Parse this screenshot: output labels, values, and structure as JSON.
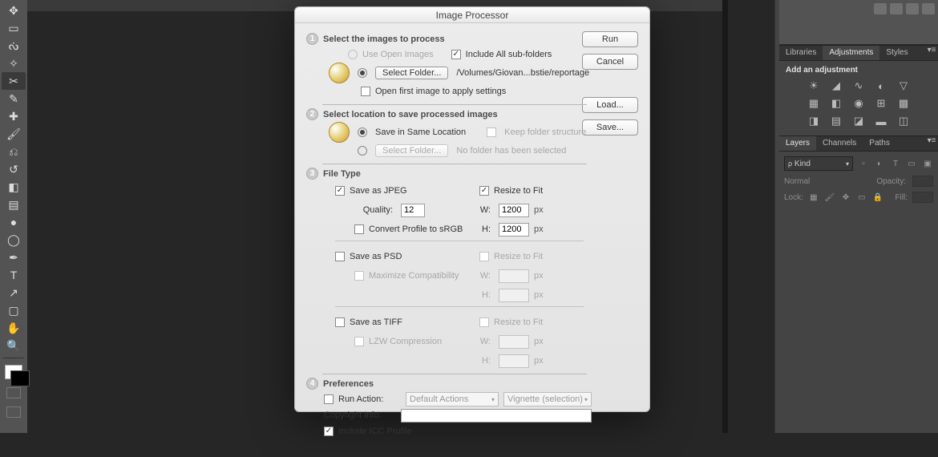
{
  "dialog": {
    "title": "Image Processor",
    "buttons": {
      "run": "Run",
      "cancel": "Cancel",
      "load": "Load...",
      "save": "Save..."
    },
    "s1": {
      "title": "Select the images to process",
      "use_open_images": "Use Open Images",
      "include_sub": "Include All sub-folders",
      "select_folder_btn": "Select Folder...",
      "folder_path": "/Volumes/Giovan...bstie/reportage",
      "open_first": "Open first image to apply settings"
    },
    "s2": {
      "title": "Select location to save processed images",
      "same_loc": "Save in Same Location",
      "keep_struct": "Keep folder structure",
      "select_folder_btn": "Select Folder...",
      "no_folder": "No folder has been selected"
    },
    "s3": {
      "title": "File Type",
      "save_jpeg": "Save as JPEG",
      "resize_fit": "Resize to Fit",
      "quality_lbl": "Quality:",
      "quality_val": "12",
      "w_lbl": "W:",
      "h_lbl": "H:",
      "jpeg_w": "1200",
      "jpeg_h": "1200",
      "px": "px",
      "srgb": "Convert Profile to sRGB",
      "save_psd": "Save as PSD",
      "max_compat": "Maximize Compatibility",
      "save_tiff": "Save as TIFF",
      "lzw": "LZW Compression"
    },
    "s4": {
      "title": "Preferences",
      "run_action": "Run Action:",
      "action_set": "Default Actions",
      "action_name": "Vignette (selection)",
      "copyright_lbl": "Copyright Info:",
      "copyright_val": "",
      "icc": "Include ICC Profile"
    }
  },
  "panels": {
    "tabs1": {
      "libraries": "Libraries",
      "adjustments": "Adjustments",
      "styles": "Styles"
    },
    "adj_text": "Add an adjustment",
    "tabs2": {
      "layers": "Layers",
      "channels": "Channels",
      "paths": "Paths"
    },
    "kind": "Kind",
    "blend": "Normal",
    "opacity_lbl": "Opacity:",
    "lock_lbl": "Lock:",
    "fill_lbl": "Fill:"
  }
}
